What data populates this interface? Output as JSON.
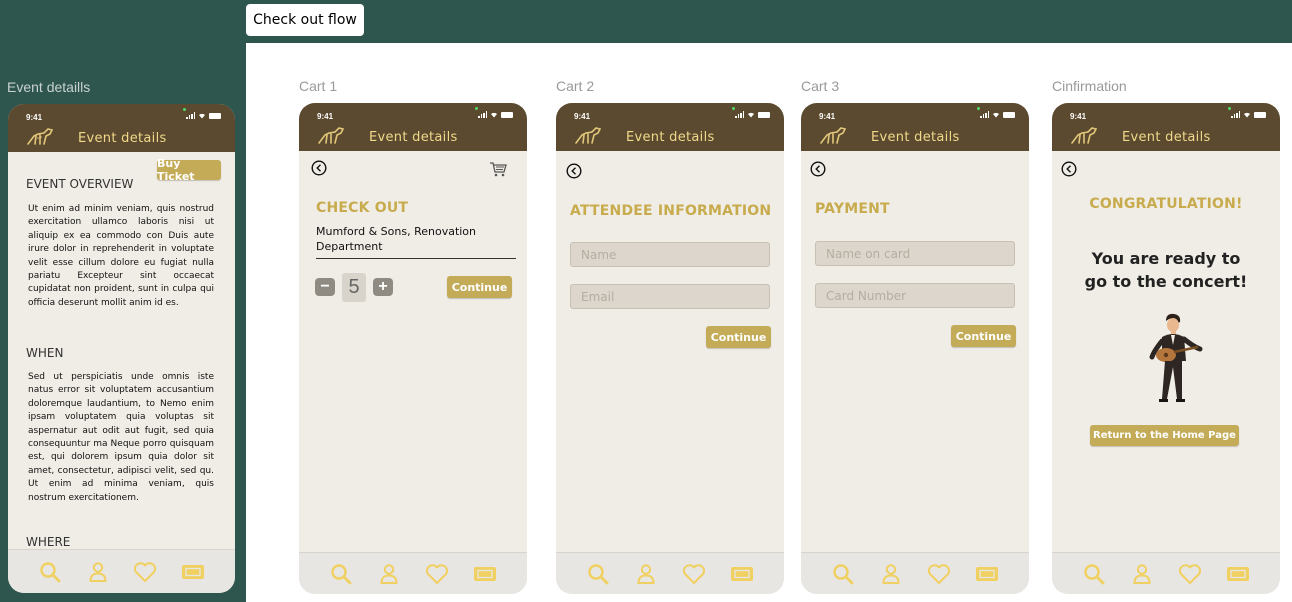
{
  "flow_tab": "Check out flow",
  "labels": {
    "event": "Event detaills",
    "cart1": "Cart 1",
    "cart2": "Cart 2",
    "cart3": "Cart 3",
    "confirm": "Cinfirmation"
  },
  "phone": {
    "time": "9:41",
    "app_title": "Event details"
  },
  "colors": {
    "topbar": "#5b4a2f",
    "accent": "#c3ab58",
    "heading": "#c7ab4d",
    "nav_icon": "#f0d061",
    "canvas_bg": "#2f554f"
  },
  "event": {
    "buy_ticket": "Buy Ticket",
    "overview_title": "EVENT OVERVIEW",
    "overview_text": "Ut enim ad minim veniam, quis nostrud exercitation ullamco laboris nisi ut aliquip ex ea commodo con Duis aute irure dolor in reprehenderit in voluptate velit esse cillum dolore eu fugiat nulla pariatu Excepteur sint occaecat cupidatat non proident, sunt in culpa qui officia deserunt mollit anim id es.",
    "when_title": "WHEN",
    "when_text": "Sed ut perspiciatis unde omnis iste natus error sit voluptatem accusantium doloremque laudantium, to Nemo enim ipsam voluptatem quia voluptas sit aspernatur aut odit aut fugit, sed quia consequuntur ma Neque porro quisquam est, qui dolorem ipsum quia dolor sit amet, consectetur, adipisci velit, sed qu. Ut enim ad minima veniam, quis nostrum exercitationem.",
    "where_title": "WHERE"
  },
  "cart1": {
    "title": "CHECK OUT",
    "item_name": "Mumford & Sons, Renovation Department",
    "quantity": "5",
    "minus": "−",
    "plus": "+",
    "continue": "Continue"
  },
  "cart2": {
    "title": "ATTENDEE INFORMATION",
    "name_placeholder": "Name",
    "email_placeholder": "Email",
    "continue": "Continue"
  },
  "cart3": {
    "title": "PAYMENT",
    "card_name_placeholder": "Name on card",
    "card_number_placeholder": "Card Number",
    "continue": "Continue"
  },
  "confirm": {
    "title": "CONGRATULATION!",
    "message_line1": "You are ready to",
    "message_line2": "go to the concert!",
    "return": "Return to the Home Page"
  },
  "nav_icons": [
    "search-icon",
    "profile-icon",
    "heart-icon",
    "ticket-icon"
  ]
}
